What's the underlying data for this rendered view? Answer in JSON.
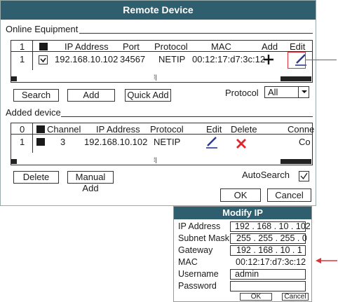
{
  "dialog": {
    "title": "Remote Device",
    "online_section": "Online Equipment",
    "online_table": {
      "headers": [
        "1",
        "",
        "IP Address",
        "Port",
        "Protocol",
        "MAC",
        "Add",
        "Edit"
      ],
      "row": {
        "index": "1",
        "ip": "192.168.10.102",
        "port": "34567",
        "protocol": "NETIP",
        "mac": "00:12:17:d7:3c:12"
      }
    },
    "buttons": {
      "search": "Search",
      "add": "Add",
      "quick_add": "Quick Add",
      "delete": "Delete",
      "manual_add": "Manual Add",
      "ok": "OK",
      "cancel": "Cancel"
    },
    "protocol_label": "Protocol",
    "protocol_value": "All",
    "added_section": "Added device",
    "added_table": {
      "headers": [
        "0",
        "Channel",
        "IP Address",
        "Protocol",
        "Edit",
        "Delete",
        "Conne"
      ],
      "row": {
        "index": "1",
        "channel": "3",
        "ip": "192.168.10.102",
        "protocol": "NETIP",
        "conn": "Co"
      }
    },
    "autosearch_label": "AutoSearch",
    "autosearch_checked": true
  },
  "modify_ip": {
    "title": "Modify IP",
    "labels": {
      "ip": "IP Address",
      "subnet": "Subnet Mask",
      "gateway": "Gateway",
      "mac": "MAC",
      "username": "Username",
      "password": "Password"
    },
    "values": {
      "ip": "192 . 168 . 10  . 102",
      "subnet": "255 . 255 . 255 . 0",
      "gateway": "192 . 168 . 10  . 1",
      "mac": "00:12:17:d7:3c:12",
      "username": "admin",
      "password": ""
    },
    "ok": "OK",
    "cancel": "Cancel"
  },
  "colors": {
    "title_bar": "#2f5f6e",
    "annotation": "#e0303a",
    "delete_x": "#e0252b",
    "edit_pen": "#2a3a8c"
  }
}
